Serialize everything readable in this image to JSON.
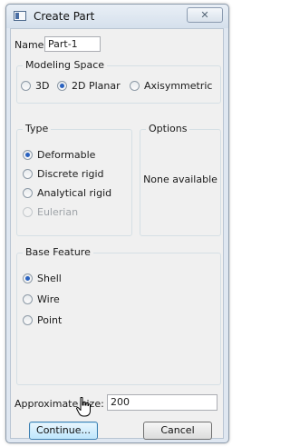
{
  "window": {
    "title": "Create Part",
    "close_label": "✕"
  },
  "name": {
    "label": "Name:",
    "value": "Part-1"
  },
  "modeling_space": {
    "title": "Modeling Space",
    "options": [
      "3D",
      "2D Planar",
      "Axisymmetric"
    ],
    "selected": "2D Planar"
  },
  "type": {
    "title": "Type",
    "options": [
      "Deformable",
      "Discrete rigid",
      "Analytical rigid",
      "Eulerian"
    ],
    "selected": "Deformable",
    "disabled": [
      "Eulerian"
    ]
  },
  "options_group": {
    "title": "Options",
    "body": "None available"
  },
  "base_feature": {
    "title": "Base Feature",
    "options": [
      "Shell",
      "Wire",
      "Point"
    ],
    "selected": "Shell"
  },
  "approx_size": {
    "label": "Approximate size:",
    "value": "200"
  },
  "buttons": {
    "continue": "Continue...",
    "cancel": "Cancel"
  }
}
